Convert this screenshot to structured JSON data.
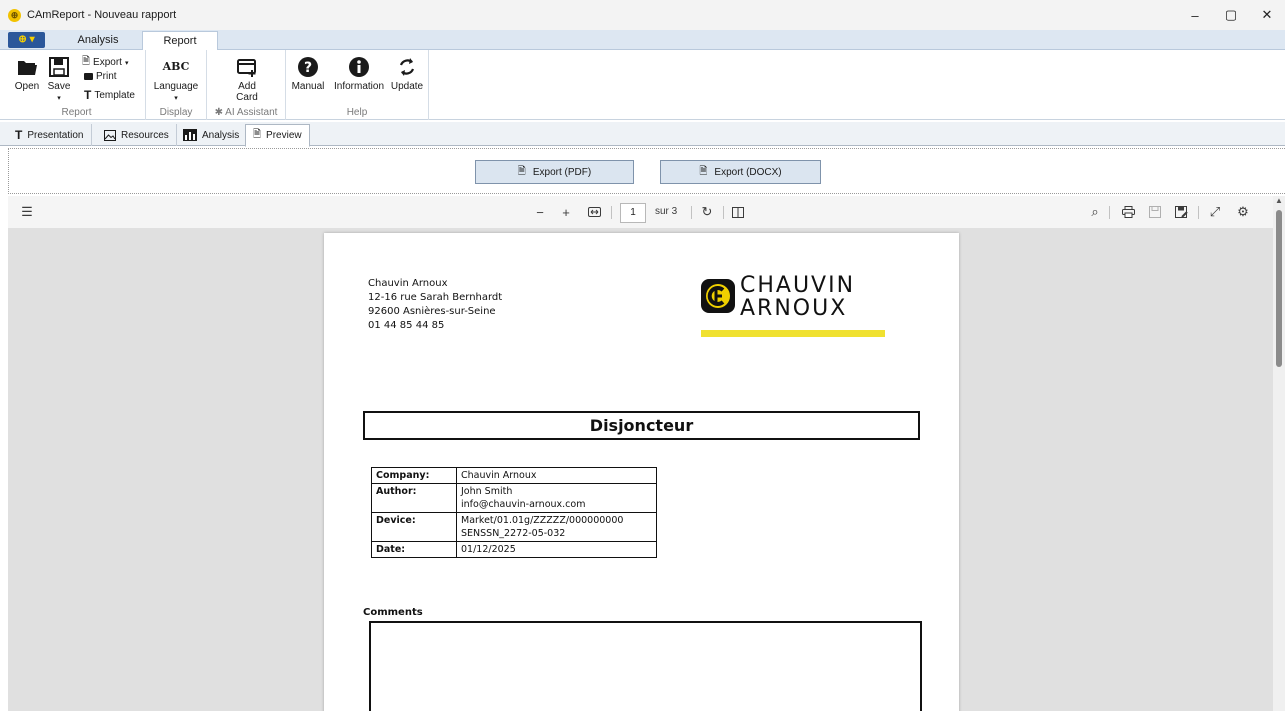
{
  "window": {
    "title": "CAmReport - Nouveau rapport",
    "app_icon": "chauvin-logo-icon",
    "controls": {
      "minimize": "–",
      "restore": "▢",
      "close": "✕"
    }
  },
  "ribbon": {
    "app_menu": "⊕ ▾",
    "tabs": [
      "Analysis",
      "Report"
    ],
    "active_tab": "Report",
    "groups": {
      "report": {
        "label": "Report",
        "open": "Open",
        "save": "Save",
        "save_arrow": "▾",
        "export": "Export",
        "export_arrow": "▾",
        "print": "Print",
        "template": "Template"
      },
      "display": {
        "label": "Display",
        "language_icon_text": "ABC",
        "language": "Language",
        "language_arrow": "▾"
      },
      "ai": {
        "label": "AI Assistant",
        "add_card_line1": "Add",
        "add_card_line2": "Card"
      },
      "help": {
        "label": "Help",
        "manual": "Manual",
        "information": "Information",
        "update": "Update"
      }
    }
  },
  "doc_tabs": [
    "Presentation",
    "Resources",
    "Analysis",
    "Preview"
  ],
  "active_doc_tab": "Preview",
  "export": {
    "pdf": "Export (PDF)",
    "docx": "Export (DOCX)"
  },
  "pdf_toolbar": {
    "page": "1",
    "page_of": "sur 3"
  },
  "document": {
    "address": [
      "Chauvin Arnoux",
      "12-16 rue Sarah Bernhardt",
      "92600 Asnières-sur-Seine",
      "01 44 85 44 85"
    ],
    "logo_line1": "CHAUVIN",
    "logo_line2": "ARNOUX",
    "logo_color": "#f0e130",
    "title": "Disjoncteur",
    "info_rows": [
      {
        "key": "Company:",
        "value": "Chauvin Arnoux"
      },
      {
        "key": "Author:",
        "value": "John Smith",
        "value2": "info@chauvin-arnoux.com"
      },
      {
        "key": "Device:",
        "value": "Market/01.01g/ZZZZZ/000000000",
        "value2": "SENSSN_2272-05-032"
      },
      {
        "key": "Date:",
        "value": "01/12/2025"
      }
    ],
    "comments_label": "Comments"
  },
  "colors": {
    "ribbon_tab_bg": "#dde7f2",
    "export_btn_bg": "#dbe5f0",
    "viewer_bg": "#e0e0e0",
    "accent": "#2b579a"
  }
}
